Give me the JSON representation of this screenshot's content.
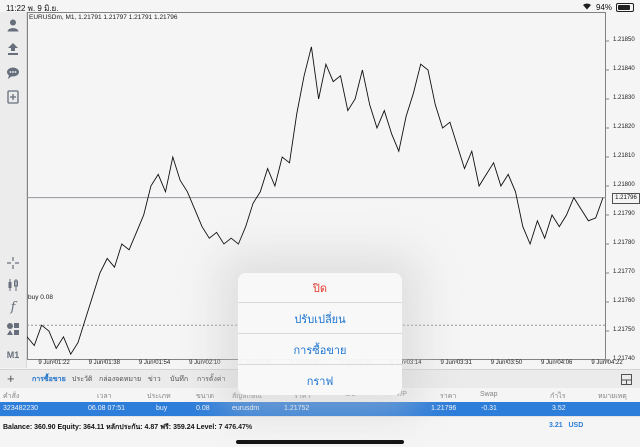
{
  "status_bar": {
    "time": "11:22",
    "date": "พ. 9 มิ.ย.",
    "battery": "94%"
  },
  "chart": {
    "symbol_info": "EURUSDm, M1, 1.21791 1.21797 1.21791 1.21796",
    "bid_price": "1.21796",
    "buy_line_label": "buy 0.08"
  },
  "chart_data": {
    "type": "line",
    "symbol": "EURUSDm",
    "timeframe": "M1",
    "ylim": [
      1.2174,
      1.2186
    ],
    "price_ticks": [
      "1.21850",
      "1.21840",
      "1.21830",
      "1.21820",
      "1.21810",
      "1.21800",
      "1.21790",
      "1.21780",
      "1.21770",
      "1.21760",
      "1.21750",
      "1.21740"
    ],
    "time_ticks": [
      "9 Jun 01:22",
      "9 Jun 01:38",
      "9 Jun 01:54",
      "9 Jun 02:10",
      "9 Jun 02:26",
      "9 Jun 02:42",
      "9 Jun 02:58",
      "9 Jun 03:14",
      "9 Jun 03:31",
      "9 Jun 03:50",
      "9 Jun 04:06",
      "9 Jun 04:22"
    ],
    "bid": 1.21796,
    "buy_level": 1.21752,
    "values": [
      1.21748,
      1.21745,
      1.21752,
      1.2175,
      1.21744,
      1.21748,
      1.21742,
      1.21746,
      1.21754,
      1.21762,
      1.2177,
      1.21775,
      1.21772,
      1.2178,
      1.21778,
      1.21784,
      1.2179,
      1.218,
      1.21804,
      1.21798,
      1.2181,
      1.21802,
      1.21798,
      1.21792,
      1.21786,
      1.21782,
      1.21784,
      1.2178,
      1.21782,
      1.2178,
      1.21786,
      1.21794,
      1.21798,
      1.21806,
      1.218,
      1.2181,
      1.21808,
      1.21825,
      1.21838,
      1.21848,
      1.2183,
      1.21842,
      1.21836,
      1.21838,
      1.21826,
      1.2183,
      1.2184,
      1.21828,
      1.2182,
      1.21826,
      1.21818,
      1.21812,
      1.21824,
      1.21832,
      1.21842,
      1.2184,
      1.21828,
      1.2182,
      1.21822,
      1.21814,
      1.21806,
      1.21812,
      1.218,
      1.21804,
      1.21808,
      1.218,
      1.21804,
      1.21798,
      1.21786,
      1.2178,
      1.21788,
      1.21782,
      1.2179,
      1.21786,
      1.2179,
      1.21796,
      1.21792,
      1.21788,
      1.21789,
      1.21796
    ]
  },
  "toolbar_icons": [
    "user-icon",
    "trade-icon",
    "chat-icon",
    "new-order-icon",
    "crosshair-icon",
    "candle-icon",
    "function-icon",
    "objects-icon",
    "timeframe-m1"
  ],
  "timeframe_label": "M1",
  "tabs": [
    {
      "label": "การซื้อขาย",
      "active": true
    },
    {
      "label": "ประวัติ",
      "active": false
    },
    {
      "label": "กล่องจดหมาย",
      "active": false
    },
    {
      "label": "ข่าว",
      "active": false
    },
    {
      "label": "บันทึก",
      "active": false
    },
    {
      "label": "การตั้งค่า",
      "active": false
    }
  ],
  "columns": [
    "คำสั่ง",
    "เวลา",
    "ประเภท",
    "ขนาด",
    "สัญลักษณ์",
    "ราคา",
    "S/L",
    "T/P",
    "ราคา",
    "Swap",
    "กำไร",
    "หมายเหตุ"
  ],
  "position": {
    "order": "323482230",
    "time": "06.08 07:51",
    "type": "buy",
    "size": "0.08",
    "symbol": "eurusdm",
    "open_price": "1.21752",
    "current_price": "1.21796",
    "swap": "-0.31",
    "profit": "3.52"
  },
  "summary": {
    "text": "Balance: 360.90 Equity: 364.11 หลักประกัน: 4.87 ฟรี: 359.24 Level: 7 476.47%",
    "profit": "3.21",
    "currency": "USD"
  },
  "menu": {
    "close": "ปิด",
    "modify": "ปรับเปลี่ยน",
    "trade": "การซื้อขาย",
    "chart": "กราฟ"
  }
}
